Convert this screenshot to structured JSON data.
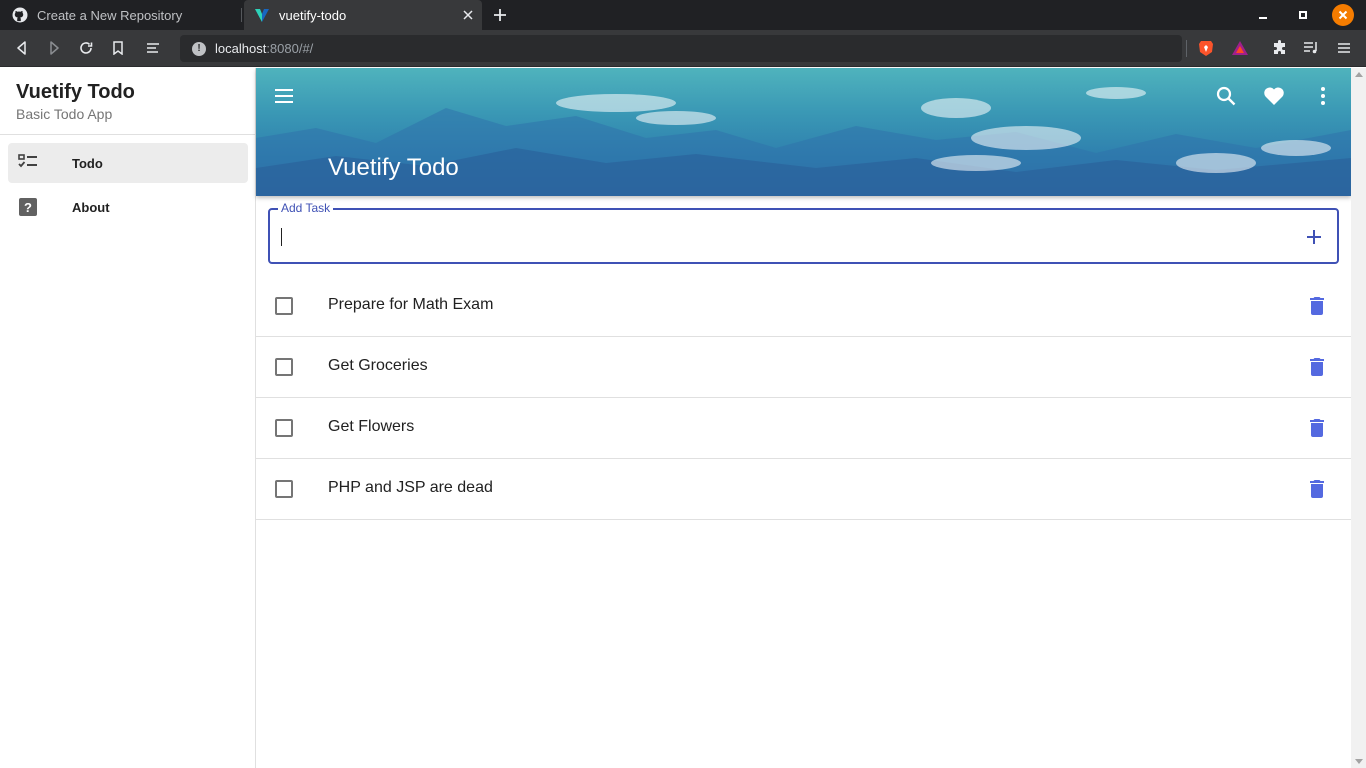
{
  "browser": {
    "tabs": [
      {
        "title": "Create a New Repository",
        "icon": "github-icon",
        "active": false
      },
      {
        "title": "vuetify-todo",
        "icon": "vuetify-icon",
        "active": true
      }
    ],
    "url": {
      "host": "localhost",
      "path": ":8080/#/"
    }
  },
  "drawer": {
    "title": "Vuetify Todo",
    "subtitle": "Basic Todo App",
    "items": [
      {
        "label": "Todo",
        "icon": "checklist-icon",
        "active": true
      },
      {
        "label": "About",
        "icon": "help-box-icon",
        "active": false
      }
    ]
  },
  "appbar": {
    "title": "Vuetify Todo",
    "icons": [
      "menu-icon",
      "search-icon",
      "heart-icon",
      "dots-vertical-icon"
    ]
  },
  "add_task": {
    "label": "Add Task",
    "value": "",
    "button_icon": "plus-icon"
  },
  "tasks": [
    {
      "title": "Prepare for Math Exam",
      "done": false
    },
    {
      "title": "Get Groceries",
      "done": false
    },
    {
      "title": "Get Flowers",
      "done": false
    },
    {
      "title": "PHP and JSP are dead",
      "done": false
    }
  ],
  "colors": {
    "primary": "#3f51b5",
    "delete_icon": "#5469e0",
    "browser_close": "#f57c00"
  }
}
